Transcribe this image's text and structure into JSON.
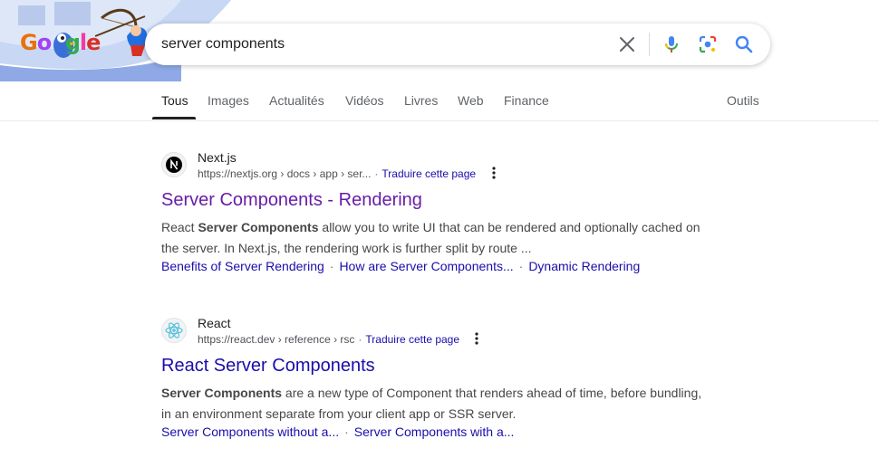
{
  "search": {
    "query": "server components"
  },
  "doodle": {
    "wordmark": [
      "G",
      "o",
      "o",
      "g",
      "l",
      "e"
    ]
  },
  "tabs": [
    {
      "label": "Tous",
      "active": true
    },
    {
      "label": "Images"
    },
    {
      "label": "Actualités"
    },
    {
      "label": "Vidéos"
    },
    {
      "label": "Livres"
    },
    {
      "label": "Web"
    },
    {
      "label": "Finance"
    }
  ],
  "tools_label": "Outils",
  "results": [
    {
      "site": "Next.js",
      "url": "https://nextjs.org › docs › app › ser...",
      "translate": "Traduire cette page",
      "title": "Server Components - Rendering",
      "snippet_parts": [
        "React ",
        "Server Components",
        " allow you to write UI that can be rendered and optionally cached on the server. In Next.js, the rendering work is further split by route ..."
      ],
      "sitelinks": [
        "Benefits of Server Rendering",
        "How are Server Components...",
        "Dynamic Rendering"
      ]
    },
    {
      "site": "React",
      "url": "https://react.dev › reference › rsc",
      "translate": "Traduire cette page",
      "title": "React Server Components",
      "snippet_parts": [
        "",
        "Server Components",
        " are a new type of Component that renders ahead of time, before bundling, in an environment separate from your client app or SSR server."
      ],
      "sitelinks": [
        "Server Components without a...",
        "Server Components with a..."
      ]
    }
  ],
  "colors": {
    "link": "#1a0dab",
    "visited": "#681da8",
    "doodle_blue": "#4285f4",
    "mic_red": "#ea4335"
  }
}
